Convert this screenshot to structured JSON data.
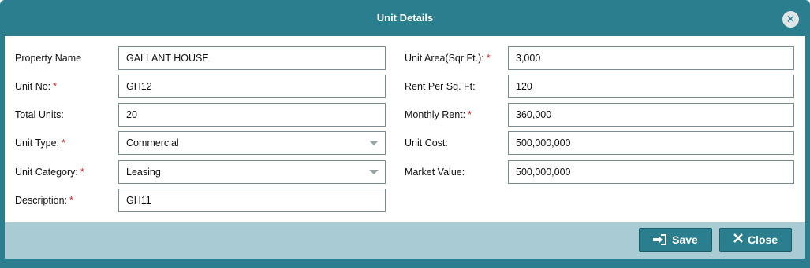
{
  "dialog": {
    "title": "Unit Details",
    "close_icon_glyph": "✕"
  },
  "left_fields": {
    "property_name": {
      "label": "Property Name",
      "required": "",
      "value": "GALLANT HOUSE"
    },
    "unit_no": {
      "label": "Unit No:",
      "required": "*",
      "value": "GH12"
    },
    "total_units": {
      "label": "Total Units:",
      "required": "",
      "value": "20"
    },
    "unit_type": {
      "label": "Unit Type:",
      "required": "*",
      "value": "Commercial"
    },
    "unit_category": {
      "label": "Unit Category:",
      "required": "*",
      "value": "Leasing"
    },
    "description": {
      "label": "Description:",
      "required": "*",
      "value": "GH11"
    }
  },
  "right_fields": {
    "unit_area": {
      "label": "Unit Area(Sqr Ft.):",
      "required": "*",
      "value": "3,000"
    },
    "rent_per_sqft": {
      "label": "Rent Per Sq. Ft:",
      "required": "",
      "value": "120"
    },
    "monthly_rent": {
      "label": "Monthly Rent:",
      "required": "*",
      "value": "360,000"
    },
    "unit_cost": {
      "label": "Unit Cost:",
      "required": "",
      "value": "500,000,000"
    },
    "market_value": {
      "label": "Market Value:",
      "required": "",
      "value": "500,000,000"
    }
  },
  "footer": {
    "save_label": "Save",
    "close_label": "Close",
    "save_icon": "sign-in-icon",
    "close_icon": "x-icon"
  },
  "colors": {
    "header": "#2a7e8e",
    "footer": "#a9ccd4",
    "required": "#d21f1f"
  }
}
